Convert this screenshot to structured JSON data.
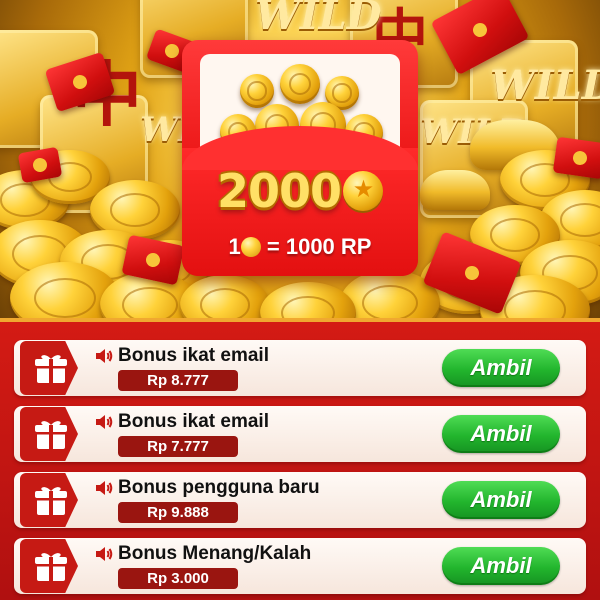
{
  "banner": {
    "amount": "2000",
    "rate_left": "1",
    "rate_right": "= 1000 RP",
    "tile_char": "中",
    "wild_text": "WILD",
    "coin_star": "★"
  },
  "bonuses": [
    {
      "title": "Bonus ikat email",
      "amount": "Rp 8.777",
      "button": "Ambil"
    },
    {
      "title": "Bonus ikat email",
      "amount": "Rp 7.777",
      "button": "Ambil"
    },
    {
      "title": "Bonus pengguna baru",
      "amount": "Rp 9.888",
      "button": "Ambil"
    },
    {
      "title": "Bonus Menang/Kalah",
      "amount": "Rp 3.000",
      "button": "Ambil"
    }
  ],
  "icons": {
    "gift": "gift-icon",
    "speaker": "speaker-icon",
    "envelope": "red-envelope-icon",
    "coin": "gold-coin-icon"
  },
  "colors": {
    "panel_red": "#c41712",
    "button_green": "#22b52d",
    "pill_red": "#9a1510",
    "gold": "#ffd23a"
  }
}
